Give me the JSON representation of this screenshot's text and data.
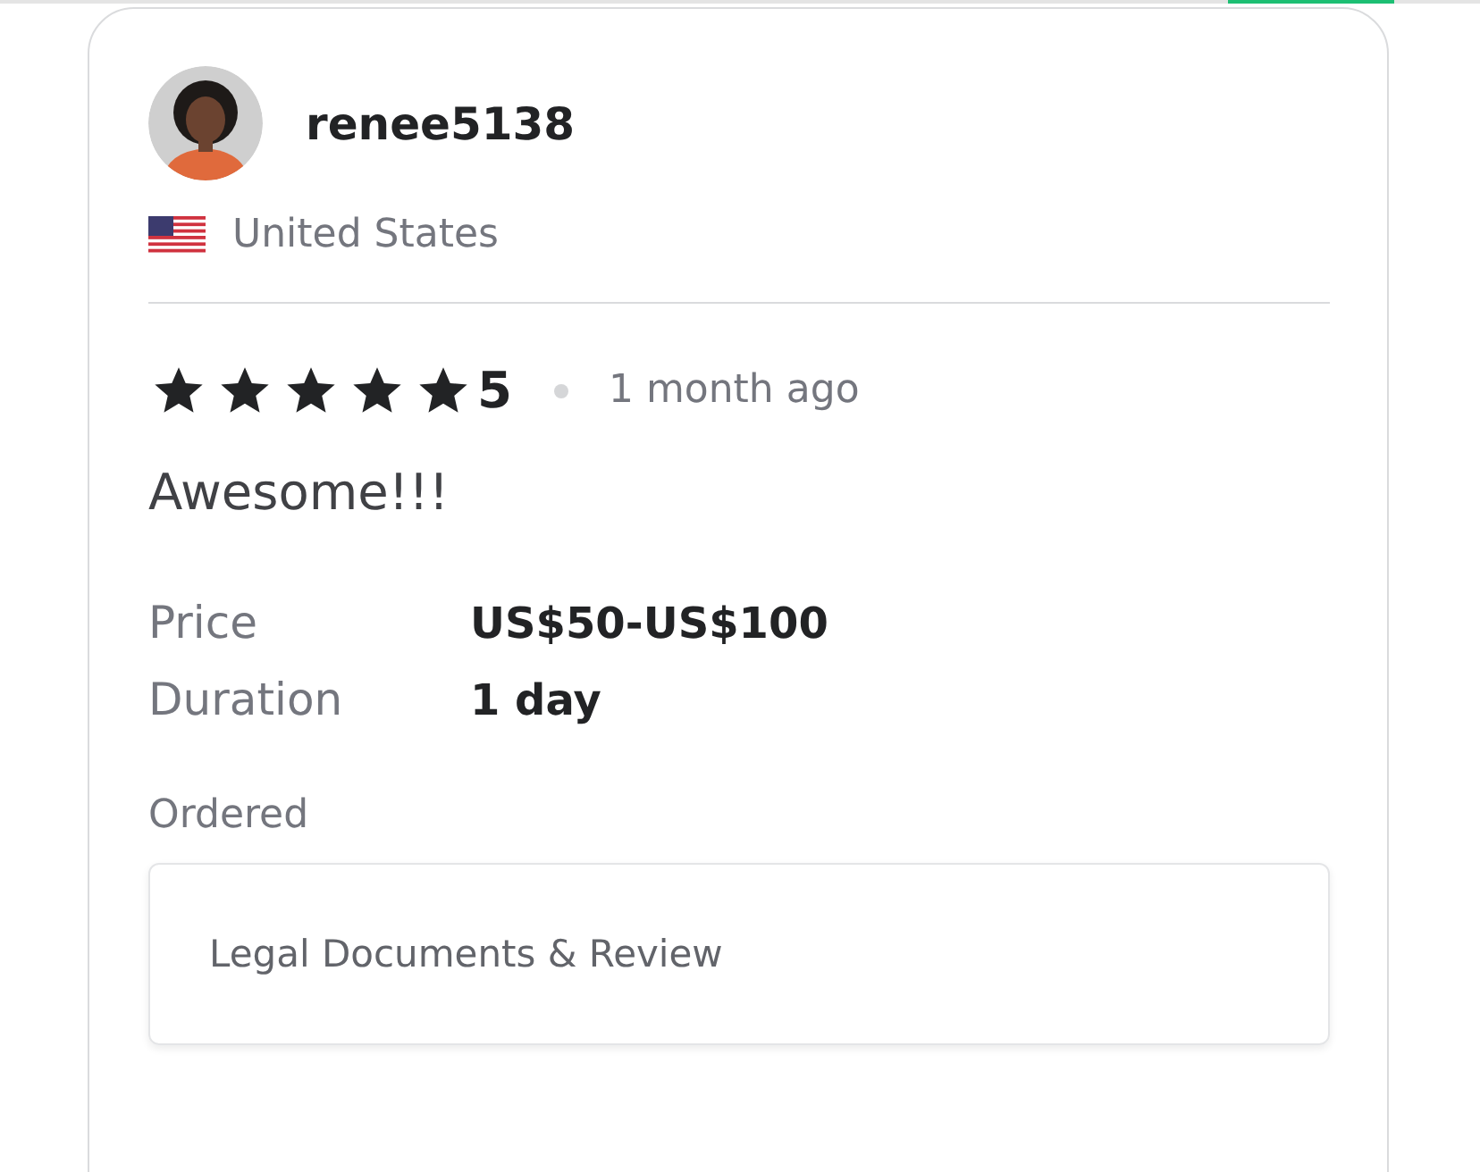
{
  "reviewer": {
    "username": "renee5138",
    "country": "United States"
  },
  "review": {
    "stars": 5,
    "rating": "5",
    "time": "1 month ago",
    "text": "Awesome!!!"
  },
  "details": [
    {
      "label": "Price",
      "value": "US$50-US$100"
    },
    {
      "label": "Duration",
      "value": "1 day"
    }
  ],
  "ordered": {
    "label": "Ordered",
    "item": "Legal Documents & Review"
  }
}
